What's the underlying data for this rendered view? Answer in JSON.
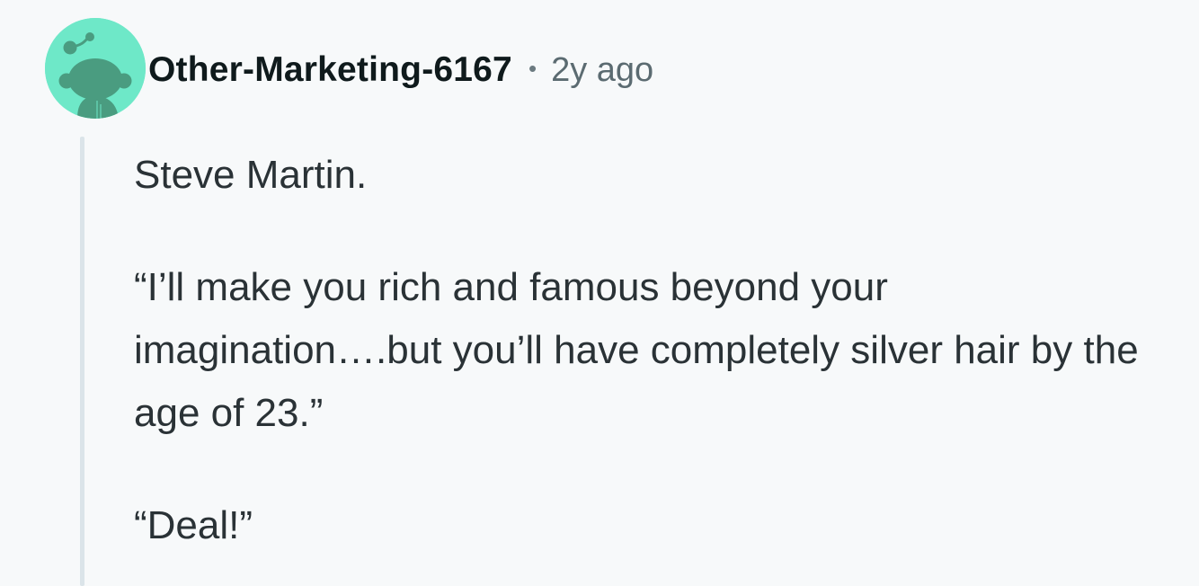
{
  "comment": {
    "author": "Other-Marketing-6167",
    "separator": "•",
    "time_ago": "2y ago",
    "avatar_icon": "reddit-snoo-avatar-icon",
    "colors": {
      "avatar_background": "#6ee8c8",
      "avatar_figure": "#4a9c80",
      "thread_line": "#dbe4e9",
      "page_background": "#f7f9fa"
    },
    "paragraphs": [
      "Steve Martin.",
      "“I’ll make you rich and famous beyond your imagination….but you’ll have completely silver hair by the age of 23.”",
      "“Deal!”"
    ]
  }
}
